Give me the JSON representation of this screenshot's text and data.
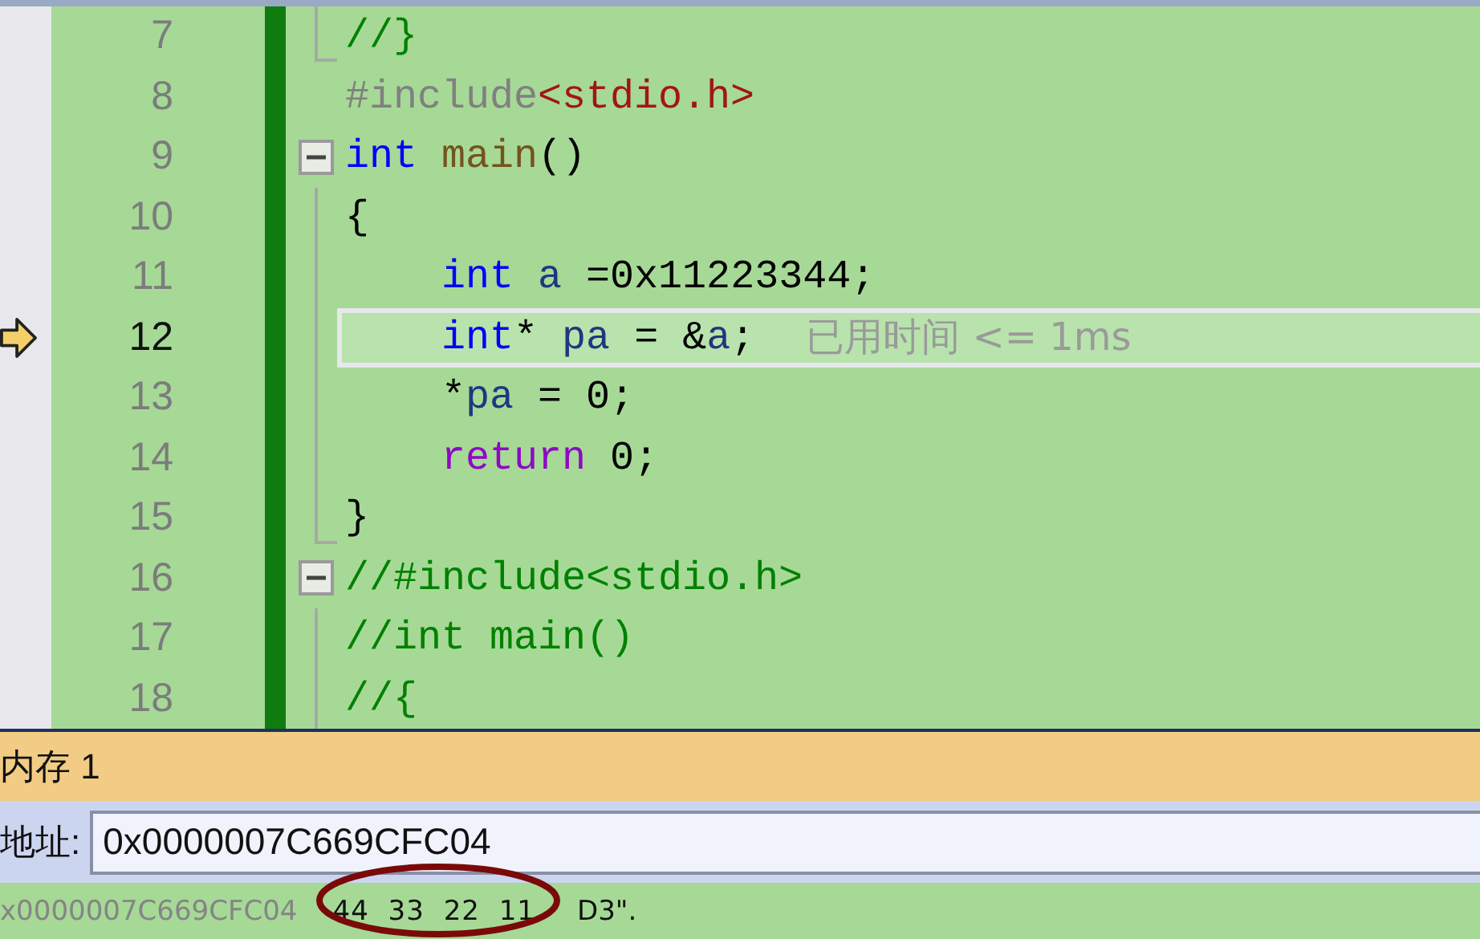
{
  "editor": {
    "lines": [
      {
        "number": "7",
        "current": false,
        "collapsible": false,
        "block_end": true,
        "tokens": [
          {
            "kind": "comment",
            "text": "//}"
          }
        ]
      },
      {
        "number": "8",
        "current": false,
        "collapsible": false,
        "block_end": false,
        "tokens": [
          {
            "kind": "preprocessor",
            "text": "#include"
          },
          {
            "kind": "string",
            "text": "<stdio.h>"
          }
        ]
      },
      {
        "number": "9",
        "current": false,
        "collapsible": true,
        "block_end": false,
        "tokens": [
          {
            "kind": "keyword",
            "text": "int"
          },
          {
            "kind": "function",
            "text": " main"
          },
          {
            "kind": "plain",
            "text": "()"
          }
        ]
      },
      {
        "number": "10",
        "current": false,
        "collapsible": false,
        "block_end": false,
        "tokens": [
          {
            "kind": "plain",
            "text": "{"
          }
        ]
      },
      {
        "number": "11",
        "current": false,
        "collapsible": false,
        "block_end": false,
        "tokens": [
          {
            "kind": "keyword",
            "text": "    int"
          },
          {
            "kind": "variable",
            "text": " a"
          },
          {
            "kind": "plain",
            "text": " =0x11223344;"
          }
        ]
      },
      {
        "number": "12",
        "current": true,
        "collapsible": false,
        "block_end": false,
        "hint": "已用时间 <= 1ms",
        "tokens": [
          {
            "kind": "keyword",
            "text": "    int"
          },
          {
            "kind": "plain",
            "text": "* "
          },
          {
            "kind": "variable",
            "text": "pa"
          },
          {
            "kind": "plain",
            "text": " = &"
          },
          {
            "kind": "variable",
            "text": "a"
          },
          {
            "kind": "plain",
            "text": ";"
          }
        ]
      },
      {
        "number": "13",
        "current": false,
        "collapsible": false,
        "block_end": false,
        "tokens": [
          {
            "kind": "plain",
            "text": "    *"
          },
          {
            "kind": "variable",
            "text": "pa"
          },
          {
            "kind": "plain",
            "text": " = 0;"
          }
        ]
      },
      {
        "number": "14",
        "current": false,
        "collapsible": false,
        "block_end": false,
        "tokens": [
          {
            "kind": "control",
            "text": "    return"
          },
          {
            "kind": "plain",
            "text": " 0;"
          }
        ]
      },
      {
        "number": "15",
        "current": false,
        "collapsible": false,
        "block_end": true,
        "tokens": [
          {
            "kind": "plain",
            "text": "}"
          }
        ]
      },
      {
        "number": "16",
        "current": false,
        "collapsible": true,
        "block_end": false,
        "tokens": [
          {
            "kind": "comment",
            "text": "//#include<stdio.h>"
          }
        ]
      },
      {
        "number": "17",
        "current": false,
        "collapsible": false,
        "block_end": false,
        "tokens": [
          {
            "kind": "comment",
            "text": "//int main()"
          }
        ]
      },
      {
        "number": "18",
        "current": false,
        "collapsible": false,
        "block_end": false,
        "tokens": [
          {
            "kind": "comment",
            "text": "//{"
          }
        ]
      }
    ]
  },
  "memory": {
    "title": "内存 1",
    "address_label": "地址:",
    "address_value": "0x0000007C669CFC04",
    "rows": [
      {
        "address": "x0000007C669CFC04",
        "bytes": "44 33 22 11",
        "ascii": "D3\".",
        "circled": true
      }
    ]
  }
}
